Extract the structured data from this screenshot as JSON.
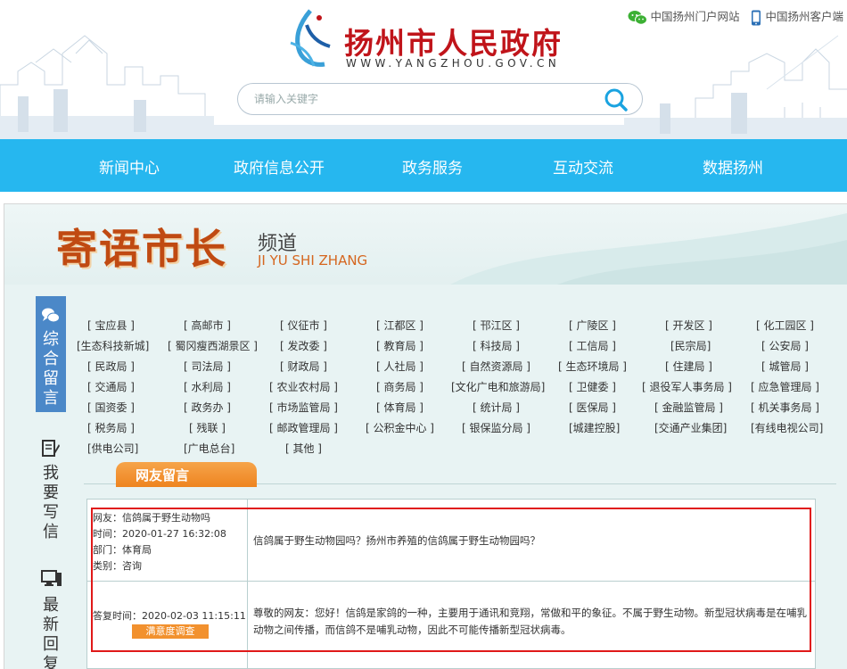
{
  "site": {
    "title": "扬州市人民政府",
    "url": "WWW.YANGZHOU.GOV.CN"
  },
  "top_links": [
    {
      "label": "中国扬州门户网站",
      "icon": "wechat-icon"
    },
    {
      "label": "中国扬州客户端",
      "icon": "mobile-icon"
    }
  ],
  "search": {
    "placeholder": "请输入关键字"
  },
  "nav": [
    {
      "label": "新闻中心"
    },
    {
      "label": "政府信息公开"
    },
    {
      "label": "政务服务"
    },
    {
      "label": "互动交流"
    },
    {
      "label": "数据扬州"
    }
  ],
  "banner": {
    "title": "寄语市长",
    "subtitle": "频道",
    "subtitle_en": "JI YU SHI ZHANG"
  },
  "side_tabs": [
    {
      "label": "综合留言",
      "icon": "chat-bubbles-icon"
    },
    {
      "label": "我要写信",
      "icon": "write-letter-icon"
    },
    {
      "label": "最新回复",
      "icon": "computer-icon"
    }
  ],
  "departments": [
    [
      "[ 宝应县 ]",
      "[ 高邮市 ]",
      "[ 仪征市 ]",
      "[ 江都区 ]",
      "[ 邗江区 ]",
      "[ 广陵区 ]",
      "[ 开发区 ]",
      "[ 化工园区 ]"
    ],
    [
      "[生态科技新城]",
      "[ 蜀冈瘦西湖景区 ]",
      "[ 发改委 ]",
      "[ 教育局 ]",
      "[ 科技局 ]",
      "[ 工信局 ]",
      "[民宗局]",
      "[ 公安局 ]"
    ],
    [
      "[ 民政局 ]",
      "[ 司法局 ]",
      "[ 财政局 ]",
      "[ 人社局 ]",
      "[ 自然资源局 ]",
      "[ 生态环境局 ]",
      "[ 住建局 ]",
      "[ 城管局 ]"
    ],
    [
      "[ 交通局 ]",
      "[ 水利局 ]",
      "[ 农业农村局 ]",
      "[ 商务局 ]",
      "[文化广电和旅游局]",
      "[ 卫健委 ]",
      "[ 退役军人事务局 ]",
      "[ 应急管理局 ]"
    ],
    [
      "[ 国资委 ]",
      "[ 政务办 ]",
      "[ 市场监管局 ]",
      "[ 体育局 ]",
      "[ 统计局 ]",
      "[ 医保局 ]",
      "[ 金融监管局 ]",
      "[ 机关事务局 ]"
    ],
    [
      "[ 税务局 ]",
      "[ 残联 ]",
      "[ 邮政管理局 ]",
      "[ 公积金中心 ]",
      "[ 银保监分局 ]",
      "[城建控股]",
      "[交通产业集团]",
      "[有线电视公司]"
    ],
    [
      "[供电公司]",
      "[广电总台]",
      "[ 其他 ]"
    ]
  ],
  "section": {
    "title": "网友留言"
  },
  "message": {
    "netizen": "网友：信鸽属于野生动物吗",
    "time": "时间：2020-01-27 16:32:08",
    "dept": "部门：体育局",
    "category": "类别：咨询",
    "question": "信鸽属于野生动物园吗？扬州市养殖的信鸽属于野生动物园吗？",
    "reply_time": "答复时间：2020-02-03 11:15:11",
    "survey_label": "满意度调查",
    "answer": "尊敬的网友：您好！信鸽是家鸽的一种，主要用于通讯和竞翔，常做和平的象征。不属于野生动物。新型冠状病毒是在哺乳动物之间传播，而信鸽不是哺乳动物，因此不可能传播新型冠状病毒。"
  },
  "colors": {
    "nav_bg": "#26b7ef",
    "brand_red": "#c0141a",
    "accent_orange": "#ee8420",
    "side_tab_blue": "#4b88c8",
    "highlight_red": "#e01919"
  }
}
